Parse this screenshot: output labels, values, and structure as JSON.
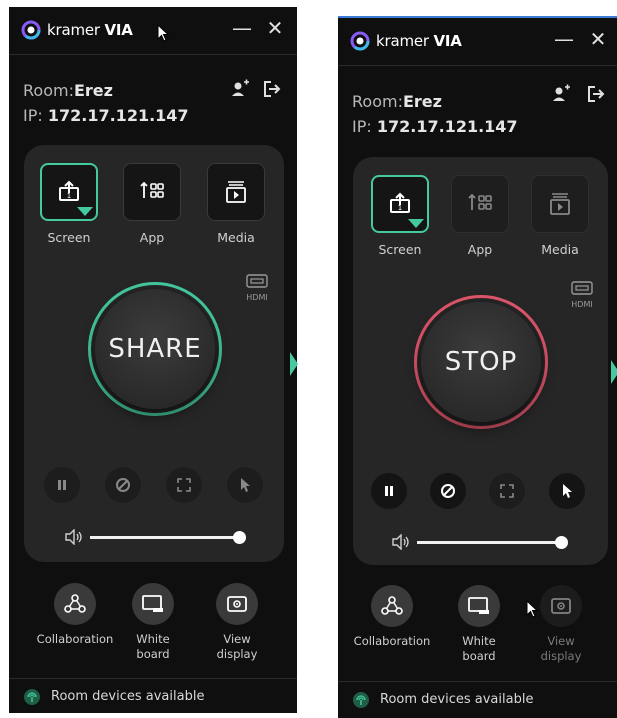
{
  "left": {
    "logo_prefix": "kramer",
    "logo_suffix": "VIA",
    "minimize": "—",
    "close": "✕",
    "room_label": "Room:",
    "room_name": "Erez",
    "ip_label": "IP:",
    "ip_value": "172.17.121.147",
    "sources": [
      {
        "label": "Screen",
        "icon": "screen-share-icon"
      },
      {
        "label": "App",
        "icon": "app-grid-icon"
      },
      {
        "label": "Media",
        "icon": "media-play-icon"
      }
    ],
    "hdmi_label": "HDMI",
    "main_button": "SHARE",
    "bottom": [
      {
        "label": "Collaboration",
        "icon": "collaboration-icon"
      },
      {
        "label": "White board",
        "icon": "whiteboard-icon"
      },
      {
        "label": "View display",
        "icon": "view-display-icon"
      }
    ],
    "footer": "Room devices available"
  },
  "right": {
    "logo_prefix": "kramer",
    "logo_suffix": "VIA",
    "minimize": "—",
    "close": "✕",
    "room_label": "Room:",
    "room_name": "Erez",
    "ip_label": "IP:",
    "ip_value": "172.17.121.147",
    "sources": [
      {
        "label": "Screen",
        "icon": "screen-share-icon"
      },
      {
        "label": "App",
        "icon": "app-grid-icon"
      },
      {
        "label": "Media",
        "icon": "media-play-icon"
      }
    ],
    "hdmi_label": "HDMI",
    "main_button": "STOP",
    "bottom": [
      {
        "label": "Collaboration",
        "icon": "collaboration-icon"
      },
      {
        "label": "White board",
        "icon": "whiteboard-icon"
      },
      {
        "label": "View display",
        "icon": "view-display-icon"
      }
    ],
    "footer": "Room devices available"
  },
  "colors": {
    "accent_green": "#45c9a0",
    "stop_red": "#e0566b",
    "background": "#0f0f0f",
    "card": "#262626"
  },
  "volume_level": 0.95
}
